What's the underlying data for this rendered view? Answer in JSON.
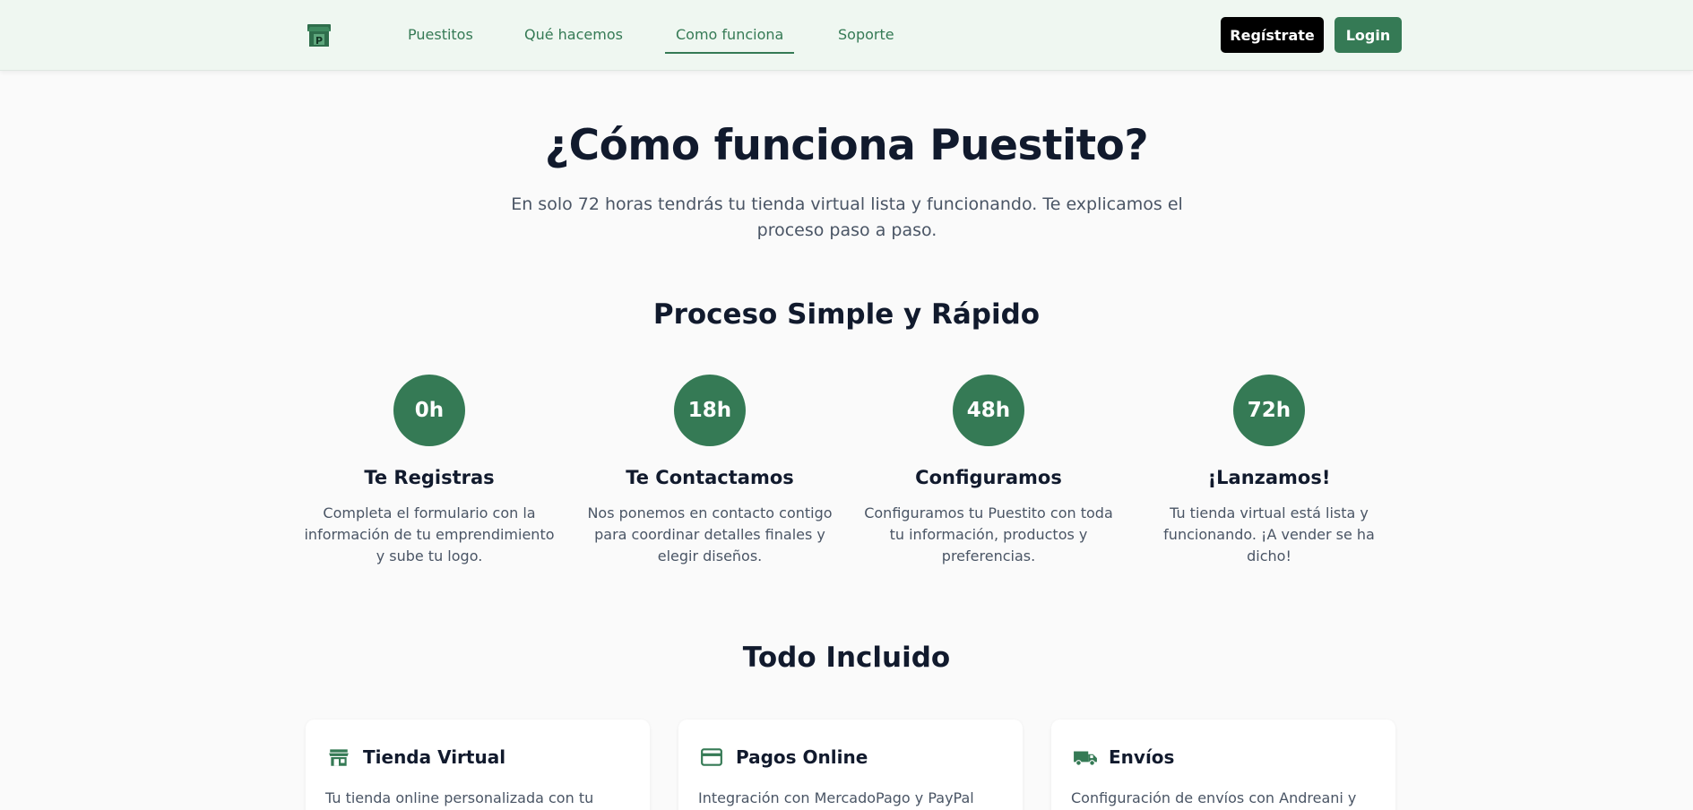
{
  "header": {
    "logo_icon": "storefront-logo-icon",
    "nav": [
      {
        "label": "Puestitos"
      },
      {
        "label": "Qué hacemos"
      },
      {
        "label": "Como funciona",
        "active": true
      },
      {
        "label": "Soporte"
      }
    ],
    "register_label": "Regístrate",
    "login_label": "Login"
  },
  "hero": {
    "title": "¿Cómo funciona Puestito?",
    "subtitle": "En solo 72 horas tendrás tu tienda virtual lista y funcionando. Te explicamos el proceso paso a paso."
  },
  "process": {
    "title": "Proceso Simple y Rápido",
    "steps": [
      {
        "time": "0h",
        "title": "Te Registras",
        "desc": "Completa el formulario con la información de tu emprendimiento y sube tu logo."
      },
      {
        "time": "18h",
        "title": "Te Contactamos",
        "desc": "Nos ponemos en contacto contigo para coordinar detalles finales y elegir diseños."
      },
      {
        "time": "48h",
        "title": "Configuramos",
        "desc": "Configuramos tu Puestito con toda tu información, productos y preferencias."
      },
      {
        "time": "72h",
        "title": "¡Lanzamos!",
        "desc": "Tu tienda virtual está lista y funcionando. ¡A vender se ha dicho!"
      }
    ]
  },
  "included": {
    "title": "Todo Incluido",
    "cards": [
      {
        "icon": "store-icon",
        "title": "Tienda Virtual",
        "desc": "Tu tienda online personalizada con tu"
      },
      {
        "icon": "credit-card-icon",
        "title": "Pagos Online",
        "desc": "Integración con MercadoPago y PayPal"
      },
      {
        "icon": "truck-icon",
        "title": "Envíos",
        "desc": "Configuración de envíos con Andreani y"
      }
    ]
  },
  "colors": {
    "brand_green": "#357a55",
    "header_bg": "#eff7f1",
    "heading": "#111a2d",
    "body_text": "#4a5565"
  }
}
